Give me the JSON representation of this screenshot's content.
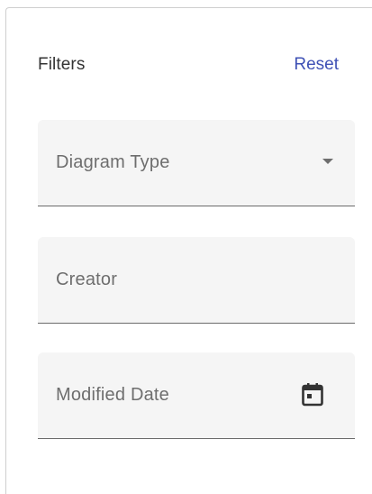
{
  "filters": {
    "title": "Filters",
    "reset_label": "Reset",
    "fields": [
      {
        "label": "Diagram Type",
        "kind": "select",
        "icon": "dropdown-arrow-icon"
      },
      {
        "label": "Creator",
        "kind": "text"
      },
      {
        "label": "Modified Date",
        "kind": "date",
        "icon": "calendar-icon"
      }
    ]
  },
  "colors": {
    "accent": "#3f51b5",
    "field_bg": "#f5f5f5",
    "label_text": "#6e6e6e",
    "underline": "#6b6b6b"
  }
}
